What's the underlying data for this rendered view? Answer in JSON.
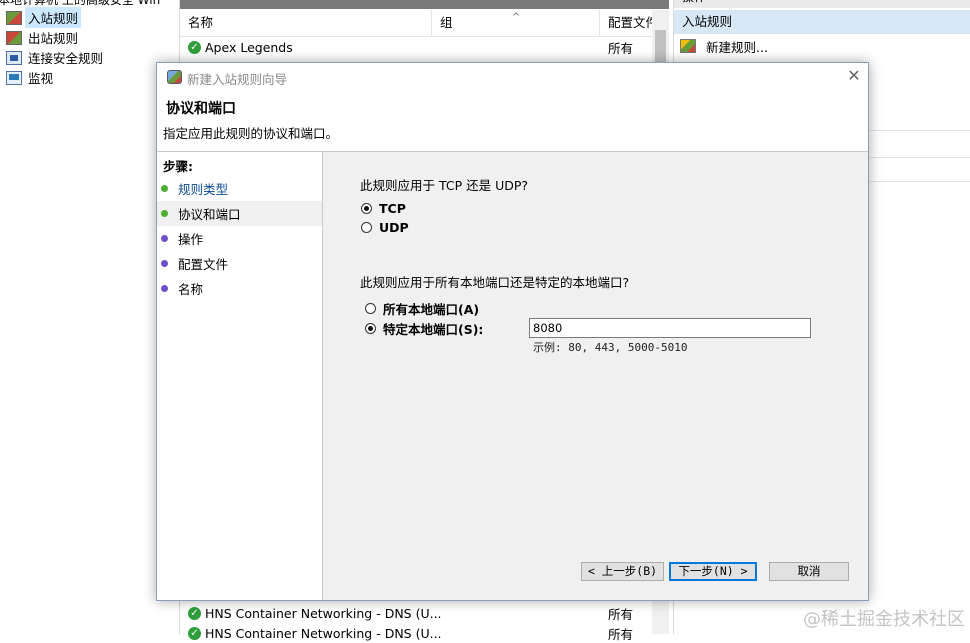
{
  "tree": {
    "root_label": "本地计算机 上的高级安全 Win",
    "items": [
      {
        "label": "入站规则",
        "icon": "inbound-rules-icon",
        "selected": true
      },
      {
        "label": "出站规则",
        "icon": "outbound-rules-icon",
        "selected": false
      },
      {
        "label": "连接安全规则",
        "icon": "connection-security-icon",
        "selected": false
      },
      {
        "label": "监视",
        "icon": "monitor-icon",
        "selected": false
      }
    ]
  },
  "list": {
    "columns": {
      "name": "名称",
      "group": "组",
      "profile": "配置文件"
    },
    "rows": [
      {
        "name": "Apex Legends",
        "profile": "所有"
      },
      {
        "name": "HNS Container Networking - DNS (U...",
        "profile": "所有"
      },
      {
        "name": "HNS Container Networking - DNS (U...",
        "profile": "所有"
      }
    ]
  },
  "actions": {
    "pane_title": "操作",
    "section": "入站规则",
    "new_rule": "新建规则..."
  },
  "dialog": {
    "title": "新建入站规则向导",
    "heading": "协议和端口",
    "subheading": "指定应用此规则的协议和端口。",
    "steps_title": "步骤:",
    "steps": [
      {
        "label": "规则类型",
        "status": "done"
      },
      {
        "label": "协议和端口",
        "status": "current"
      },
      {
        "label": "操作",
        "status": "pending"
      },
      {
        "label": "配置文件",
        "status": "pending"
      },
      {
        "label": "名称",
        "status": "pending"
      }
    ],
    "protocol_question": "此规则应用于 TCP 还是 UDP?",
    "protocol_options": {
      "tcp": "TCP",
      "udp": "UDP"
    },
    "protocol_selected": "tcp",
    "port_question": "此规则应用于所有本地端口还是特定的本地端口?",
    "port_options": {
      "all": "所有本地端口(A)",
      "specific": "特定本地端口(S):"
    },
    "port_selected": "specific",
    "port_value": "8080",
    "port_example": "示例: 80, 443, 5000-5010",
    "buttons": {
      "back": "< 上一步(B)",
      "next": "下一步(N) >",
      "cancel": "取消"
    }
  },
  "watermark": "@稀土掘金技术社区",
  "colors": {
    "selection": "#cce8ff",
    "action_section": "#d6e7f5",
    "done_step": "#4caf30",
    "pending_step": "#6e4fc7",
    "default_button_border": "#0078d7"
  }
}
